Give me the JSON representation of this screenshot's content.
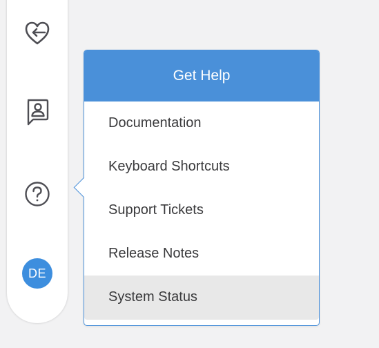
{
  "sidebar": {
    "icons": [
      {
        "name": "heart-arrow-icon",
        "label": ""
      },
      {
        "name": "contact-card-icon",
        "label": ""
      },
      {
        "name": "help-circle-icon",
        "label": ""
      }
    ],
    "avatar": {
      "initials": "DE",
      "color": "#3d8ede"
    }
  },
  "help_menu": {
    "title": "Get Help",
    "accent_color": "#4a90d9",
    "items": [
      {
        "label": "Documentation"
      },
      {
        "label": "Keyboard Shortcuts"
      },
      {
        "label": "Support Tickets"
      },
      {
        "label": "Release Notes"
      },
      {
        "label": "System Status",
        "hovered": true
      }
    ]
  }
}
